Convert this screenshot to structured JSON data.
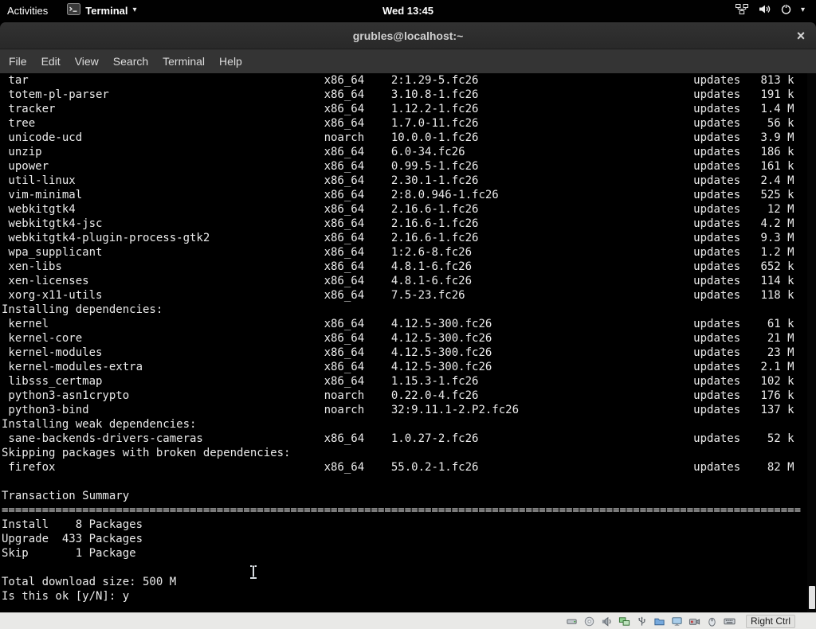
{
  "colors": {
    "topbar_bg": "#010101",
    "titlebar_bg": "#323232",
    "menubar_bg": "#343434",
    "terminal_bg": "#000000",
    "terminal_fg": "#ebebeb",
    "statusbar_bg": "#e9e9e7"
  },
  "icons": {
    "close": "×",
    "caret": "▾"
  },
  "top_bar": {
    "activities_label": "Activities",
    "app_name": "Terminal",
    "clock": "Wed 13:45"
  },
  "window": {
    "title": "grubles@localhost:~"
  },
  "menu_bar": {
    "items": [
      "File",
      "Edit",
      "View",
      "Search",
      "Terminal",
      "Help"
    ]
  },
  "terminal": {
    "lines": [
      {
        "name": "tar",
        "arch": "x86_64",
        "version": "2:1.29-5.fc26",
        "repo": "updates",
        "size": "813 k"
      },
      {
        "name": "totem-pl-parser",
        "arch": "x86_64",
        "version": "3.10.8-1.fc26",
        "repo": "updates",
        "size": "191 k"
      },
      {
        "name": "tracker",
        "arch": "x86_64",
        "version": "1.12.2-1.fc26",
        "repo": "updates",
        "size": "1.4 M"
      },
      {
        "name": "tree",
        "arch": "x86_64",
        "version": "1.7.0-11.fc26",
        "repo": "updates",
        "size": "56 k"
      },
      {
        "name": "unicode-ucd",
        "arch": "noarch",
        "version": "10.0.0-1.fc26",
        "repo": "updates",
        "size": "3.9 M"
      },
      {
        "name": "unzip",
        "arch": "x86_64",
        "version": "6.0-34.fc26",
        "repo": "updates",
        "size": "186 k"
      },
      {
        "name": "upower",
        "arch": "x86_64",
        "version": "0.99.5-1.fc26",
        "repo": "updates",
        "size": "161 k"
      },
      {
        "name": "util-linux",
        "arch": "x86_64",
        "version": "2.30.1-1.fc26",
        "repo": "updates",
        "size": "2.4 M"
      },
      {
        "name": "vim-minimal",
        "arch": "x86_64",
        "version": "2:8.0.946-1.fc26",
        "repo": "updates",
        "size": "525 k"
      },
      {
        "name": "webkitgtk4",
        "arch": "x86_64",
        "version": "2.16.6-1.fc26",
        "repo": "updates",
        "size": "12 M"
      },
      {
        "name": "webkitgtk4-jsc",
        "arch": "x86_64",
        "version": "2.16.6-1.fc26",
        "repo": "updates",
        "size": "4.2 M"
      },
      {
        "name": "webkitgtk4-plugin-process-gtk2",
        "arch": "x86_64",
        "version": "2.16.6-1.fc26",
        "repo": "updates",
        "size": "9.3 M"
      },
      {
        "name": "wpa_supplicant",
        "arch": "x86_64",
        "version": "1:2.6-8.fc26",
        "repo": "updates",
        "size": "1.2 M"
      },
      {
        "name": "xen-libs",
        "arch": "x86_64",
        "version": "4.8.1-6.fc26",
        "repo": "updates",
        "size": "652 k"
      },
      {
        "name": "xen-licenses",
        "arch": "x86_64",
        "version": "4.8.1-6.fc26",
        "repo": "updates",
        "size": "114 k"
      },
      {
        "name": "xorg-x11-utils",
        "arch": "x86_64",
        "version": "7.5-23.fc26",
        "repo": "updates",
        "size": "118 k"
      },
      {
        "text": "Installing dependencies:"
      },
      {
        "name": "kernel",
        "arch": "x86_64",
        "version": "4.12.5-300.fc26",
        "repo": "updates",
        "size": "61 k"
      },
      {
        "name": "kernel-core",
        "arch": "x86_64",
        "version": "4.12.5-300.fc26",
        "repo": "updates",
        "size": "21 M"
      },
      {
        "name": "kernel-modules",
        "arch": "x86_64",
        "version": "4.12.5-300.fc26",
        "repo": "updates",
        "size": "23 M"
      },
      {
        "name": "kernel-modules-extra",
        "arch": "x86_64",
        "version": "4.12.5-300.fc26",
        "repo": "updates",
        "size": "2.1 M"
      },
      {
        "name": "libsss_certmap",
        "arch": "x86_64",
        "version": "1.15.3-1.fc26",
        "repo": "updates",
        "size": "102 k"
      },
      {
        "name": "python3-asn1crypto",
        "arch": "noarch",
        "version": "0.22.0-4.fc26",
        "repo": "updates",
        "size": "176 k"
      },
      {
        "name": "python3-bind",
        "arch": "noarch",
        "version": "32:9.11.1-2.P2.fc26",
        "repo": "updates",
        "size": "137 k"
      },
      {
        "text": "Installing weak dependencies:"
      },
      {
        "name": "sane-backends-drivers-cameras",
        "arch": "x86_64",
        "version": "1.0.27-2.fc26",
        "repo": "updates",
        "size": "52 k"
      },
      {
        "text": "Skipping packages with broken dependencies:"
      },
      {
        "name": "firefox",
        "arch": "x86_64",
        "version": "55.0.2-1.fc26",
        "repo": "updates",
        "size": "82 M"
      }
    ],
    "summary": {
      "title": "Transaction Summary",
      "separator_char": "=",
      "separator_length": 119,
      "rows": [
        {
          "action": "Install",
          "count": "8",
          "unit": "Packages"
        },
        {
          "action": "Upgrade",
          "count": "433",
          "unit": "Packages"
        },
        {
          "action": "Skip",
          "count": "1",
          "unit": "Package"
        }
      ],
      "total": "Total download size: 500 M",
      "prompt": "Is this ok [y/N]: y"
    }
  },
  "vbox_bar": {
    "host_key": "Right Ctrl"
  }
}
